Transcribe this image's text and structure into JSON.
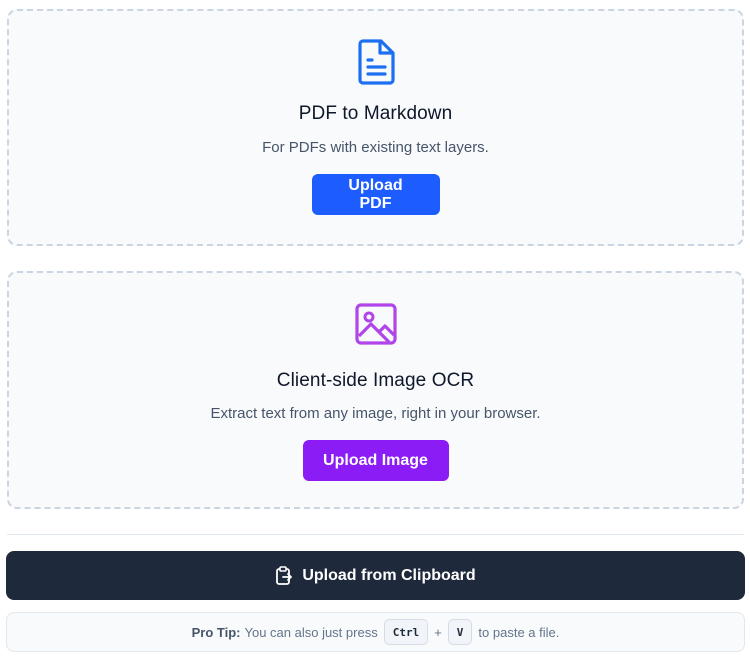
{
  "pdf_card": {
    "icon": "document-text-icon",
    "title": "PDF to Markdown",
    "description": "For PDFs with existing text layers.",
    "button_label": "Upload PDF",
    "accent_color": "#1d5cff"
  },
  "image_card": {
    "icon": "image-icon",
    "title": "Client-side Image OCR",
    "description": "Extract text from any image, right in your browser.",
    "button_label": "Upload Image",
    "accent_color": "#8b1cf5"
  },
  "clipboard": {
    "icon": "clipboard-paste-icon",
    "button_label": "Upload from Clipboard"
  },
  "pro_tip": {
    "label": "Pro Tip:",
    "text_before": "You can also just press",
    "key_1": "Ctrl",
    "plus": "+",
    "key_2": "V",
    "text_after": "to paste a file."
  }
}
